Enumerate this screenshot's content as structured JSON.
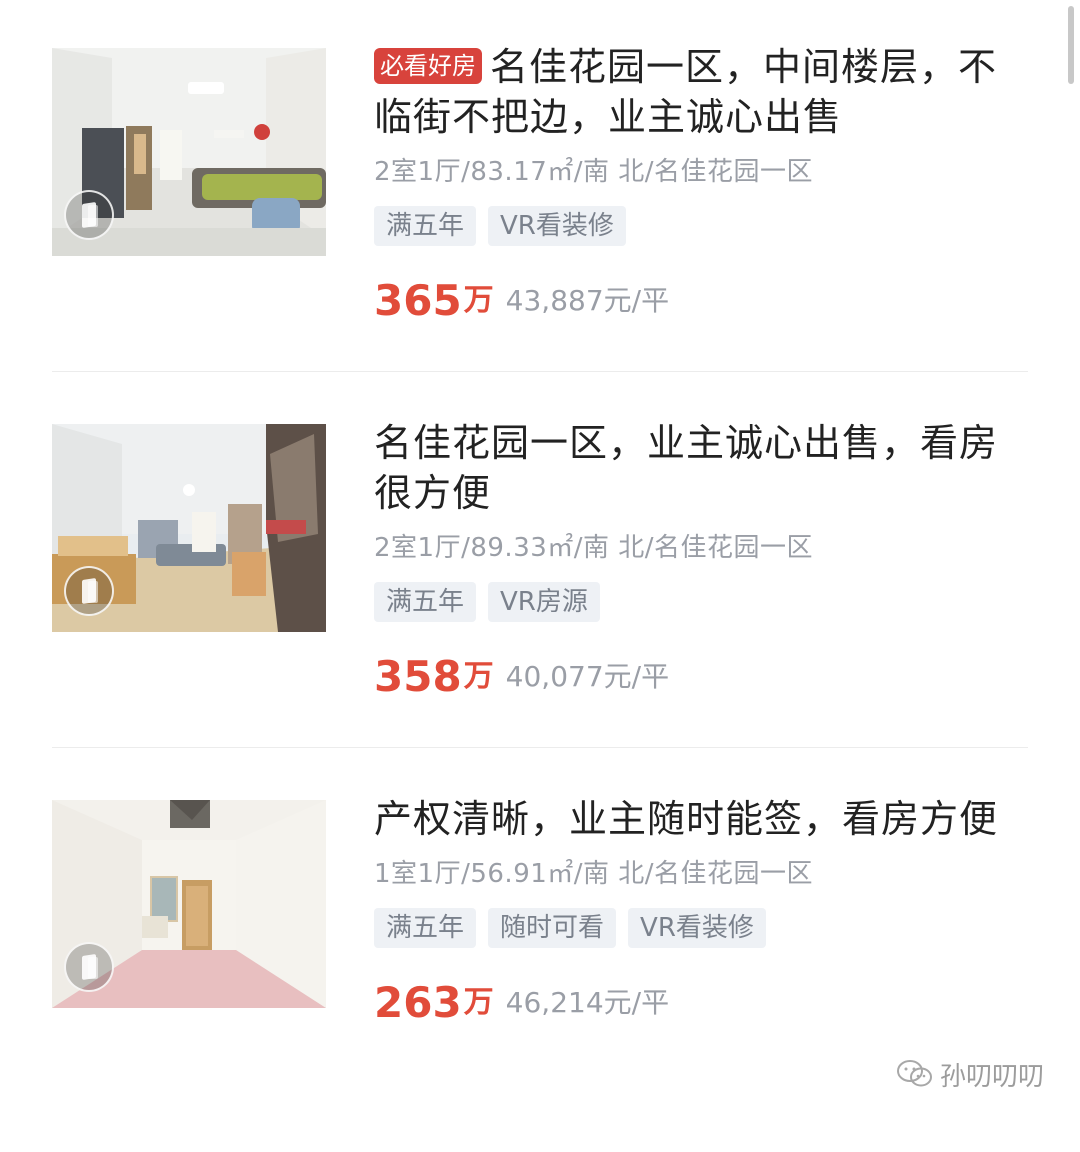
{
  "listings": [
    {
      "badge": "必看好房",
      "title": "名佳花园一区，中间楼层，不临街不把边，业主诚心出售",
      "meta": "2室1厅/83.17㎡/南 北/名佳花园一区",
      "tags": [
        "满五年",
        "VR看装修"
      ],
      "price_total": "365",
      "price_unit": "万",
      "price_per": "43,887元/平"
    },
    {
      "title": "名佳花园一区，业主诚心出售，看房很方便",
      "meta": "2室1厅/89.33㎡/南 北/名佳花园一区",
      "tags": [
        "满五年",
        "VR房源"
      ],
      "price_total": "358",
      "price_unit": "万",
      "price_per": "40,077元/平"
    },
    {
      "title": "产权清晰，业主随时能签，看房方便",
      "meta": "1室1厅/56.91㎡/南 北/名佳花园一区",
      "tags": [
        "满五年",
        "随时可看",
        "VR看装修"
      ],
      "price_total": "263",
      "price_unit": "万",
      "price_per": "46,214元/平"
    }
  ],
  "watermark": {
    "icon": "wechat-icon",
    "text": "孙叨叨叨"
  },
  "colors": {
    "price": "#e14c3a",
    "badge": "#d8433c",
    "tag_bg": "#eef1f5",
    "muted": "#9a9ea6"
  }
}
